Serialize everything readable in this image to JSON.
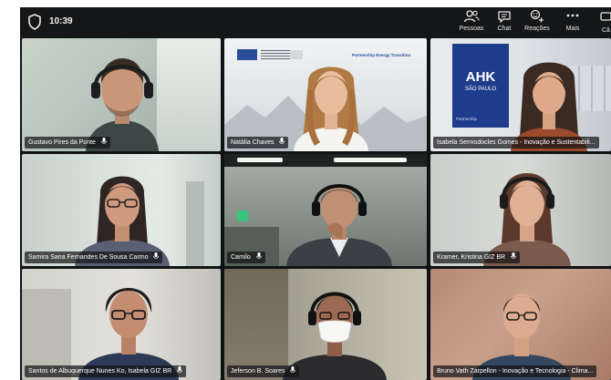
{
  "status": {
    "time": "10:39"
  },
  "toolbar": {
    "people_label": "Pessoas",
    "chat_label": "Chat",
    "reactions_label": "Reações",
    "more_label": "Mais",
    "cut_label": "Câ"
  },
  "participants": [
    {
      "name": "Gustavo Pires da Ponte"
    },
    {
      "name": "Natália Chaves"
    },
    {
      "name": "Isabela Sernisdocles Gomes - Inovação e Sustentabili..."
    },
    {
      "name": "Samira Sana Fernandes De Sousa Carmo"
    },
    {
      "name": "Camilo"
    },
    {
      "name": "Kramer, Kristina GIZ BR"
    },
    {
      "name": "Santos de Albuquerque Nunes Ko, Isabela GIZ BR"
    },
    {
      "name": "Jeferson B. Soares"
    },
    {
      "name": "Bruno Vath Zarpellon - Inovação e Tecnologia - Clima..."
    }
  ],
  "backgrounds": {
    "tile2_banner": "Partnership Energy Transition",
    "tile3_logo_main": "AHK",
    "tile3_logo_sub": "SÃO PAULO",
    "tile3_banner": "Partnership"
  },
  "colors": {
    "active_border": "#6e75c9",
    "topbar": "#151618",
    "ahk_blue": "#1f3c8c"
  }
}
